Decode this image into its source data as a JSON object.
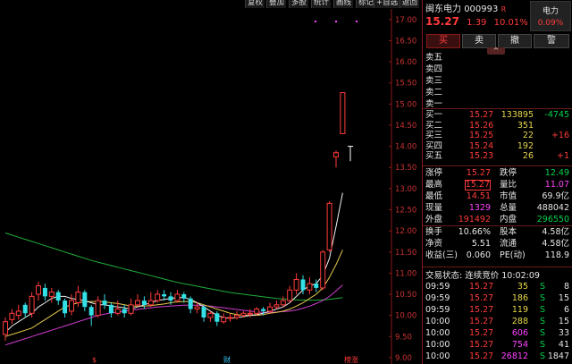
{
  "toolbar": {
    "buttons": [
      "复权",
      "叠加",
      "多股",
      "统计",
      "画线",
      "标记",
      "+自选",
      "返回"
    ]
  },
  "stock": {
    "name": "闽东电力",
    "code": "000993",
    "flag": "R",
    "price": "15.27",
    "change": "1.39",
    "pct": "10.01%",
    "sector": "电力",
    "sector_pct": "0.09%"
  },
  "actions": [
    "买",
    "卖",
    "撤",
    "警"
  ],
  "collapse": "^",
  "sell_levels": [
    {
      "label": "卖五",
      "price": "",
      "vol": ""
    },
    {
      "label": "卖四",
      "price": "",
      "vol": ""
    },
    {
      "label": "卖三",
      "price": "",
      "vol": ""
    },
    {
      "label": "卖二",
      "price": "",
      "vol": ""
    },
    {
      "label": "卖一",
      "price": "",
      "vol": ""
    }
  ],
  "buy_levels": [
    {
      "label": "买一",
      "price": "15.27",
      "vol": "133895",
      "chg": "-4745"
    },
    {
      "label": "买二",
      "price": "15.26",
      "vol": "351",
      "chg": ""
    },
    {
      "label": "买三",
      "price": "15.25",
      "vol": "22",
      "chg": "+16"
    },
    {
      "label": "买四",
      "price": "15.24",
      "vol": "192",
      "chg": ""
    },
    {
      "label": "买五",
      "price": "15.23",
      "vol": "26",
      "chg": "+1"
    }
  ],
  "stats": [
    {
      "l1": "涨停",
      "v1": "15.27",
      "l2": "跌停",
      "v2": "12.49"
    },
    {
      "l1": "最高",
      "v1": "15.27",
      "l2": "量比",
      "v2": "11.07"
    },
    {
      "l1": "最低",
      "v1": "14.51",
      "l2": "市值",
      "v2": "69.9亿"
    },
    {
      "l1": "现量",
      "v1": "1329",
      "l2": "总量",
      "v2": "488042"
    },
    {
      "l1": "外盘",
      "v1": "191492",
      "l2": "内盘",
      "v2": "296550"
    },
    {
      "l1": "换手",
      "v1": "10.66%",
      "l2": "股本",
      "v2": "4.58亿"
    },
    {
      "l1": "净资",
      "v1": "5.51",
      "l2": "流通",
      "v2": "4.58亿"
    },
    {
      "l1": "收益(三)",
      "v1": "0.060",
      "l2": "PE(动)",
      "v2": "118.9"
    }
  ],
  "trade_status": "交易状态: 连续竞价 10:02:09",
  "ticks": [
    {
      "t": "09:59",
      "p": "15.27",
      "v": "35",
      "s": "S",
      "n": "8"
    },
    {
      "t": "09:59",
      "p": "15.27",
      "v": "186",
      "s": "S",
      "n": "15"
    },
    {
      "t": "09:59",
      "p": "15.27",
      "v": "119",
      "s": "S",
      "n": "6"
    },
    {
      "t": "10:00",
      "p": "15.27",
      "v": "288",
      "s": "S",
      "n": "15"
    },
    {
      "t": "10:00",
      "p": "15.27",
      "v": "606",
      "s": "S",
      "n": "33"
    },
    {
      "t": "10:00",
      "p": "15.27",
      "v": "754",
      "s": "S",
      "n": "41"
    },
    {
      "t": "10:00",
      "p": "15.27",
      "v": "26812",
      "s": "S",
      "n": "1847"
    }
  ],
  "chart_data": {
    "type": "candlestick",
    "y_ticks": [
      "17.00",
      "16.50",
      "16.00",
      "15.50",
      "15.00",
      "14.50",
      "14.00",
      "13.50",
      "13.00",
      "12.50",
      "12.00",
      "11.50",
      "11.00",
      "10.50",
      "10.00",
      "9.50",
      "9.00"
    ],
    "ylim": [
      8.85,
      17.25
    ],
    "markers": [
      "$",
      "财",
      "榜涨"
    ],
    "candles": [
      [
        9.55,
        9.85,
        9.4,
        9.95
      ],
      [
        9.9,
        10.05,
        9.8,
        10.15
      ],
      [
        10.0,
        10.1,
        9.9,
        10.25
      ],
      [
        10.25,
        10.05,
        9.95,
        10.3
      ],
      [
        10.05,
        10.45,
        9.95,
        10.55
      ],
      [
        10.5,
        10.7,
        10.35,
        10.8
      ],
      [
        10.65,
        10.45,
        10.35,
        10.75
      ],
      [
        10.45,
        10.55,
        10.3,
        10.65
      ],
      [
        10.55,
        10.35,
        10.25,
        10.6
      ],
      [
        10.35,
        10.05,
        9.95,
        10.4
      ],
      [
        10.1,
        10.35,
        10.0,
        10.5
      ],
      [
        10.3,
        10.55,
        10.2,
        10.7
      ],
      [
        10.55,
        10.2,
        10.1,
        10.6
      ],
      [
        10.2,
        10.0,
        9.75,
        10.25
      ],
      [
        10.0,
        10.35,
        9.95,
        10.45
      ],
      [
        10.35,
        10.25,
        10.15,
        10.5
      ],
      [
        10.25,
        10.05,
        9.95,
        10.3
      ],
      [
        10.05,
        10.15,
        10.0,
        10.35
      ],
      [
        10.15,
        10.05,
        9.95,
        10.25
      ],
      [
        10.05,
        10.25,
        10.0,
        10.4
      ],
      [
        10.25,
        10.35,
        10.2,
        10.5
      ],
      [
        10.35,
        10.25,
        10.15,
        10.45
      ],
      [
        10.25,
        10.35,
        10.2,
        10.55
      ],
      [
        10.35,
        10.5,
        10.3,
        10.6
      ],
      [
        10.5,
        10.45,
        10.35,
        10.6
      ],
      [
        10.45,
        10.35,
        10.25,
        10.55
      ],
      [
        10.35,
        10.5,
        10.3,
        10.6
      ],
      [
        10.5,
        10.4,
        10.3,
        10.55
      ],
      [
        10.4,
        10.15,
        10.05,
        10.45
      ],
      [
        10.15,
        10.2,
        10.05,
        10.3
      ],
      [
        10.2,
        9.95,
        9.85,
        10.25
      ],
      [
        9.95,
        10.05,
        9.85,
        10.1
      ],
      [
        10.05,
        9.85,
        9.75,
        10.1
      ],
      [
        9.85,
        9.95,
        9.8,
        10.05
      ],
      [
        9.95,
        9.95,
        9.85,
        10.05
      ],
      [
        9.95,
        10.0,
        9.9,
        10.1
      ],
      [
        10.0,
        10.05,
        9.95,
        10.1
      ],
      [
        10.05,
        10.05,
        9.95,
        10.15
      ],
      [
        10.05,
        10.15,
        10.0,
        10.2
      ],
      [
        10.15,
        10.1,
        10.0,
        10.2
      ],
      [
        10.1,
        10.2,
        10.05,
        10.3
      ],
      [
        10.2,
        10.25,
        10.15,
        10.35
      ],
      [
        10.25,
        10.35,
        10.2,
        10.45
      ],
      [
        10.35,
        10.6,
        10.3,
        10.7
      ],
      [
        10.6,
        10.85,
        10.5,
        11.0
      ],
      [
        10.85,
        10.6,
        10.5,
        10.95
      ],
      [
        10.6,
        10.75,
        10.5,
        10.9
      ],
      [
        10.75,
        10.65,
        10.55,
        10.85
      ],
      [
        10.65,
        11.5,
        10.6,
        11.55
      ],
      [
        11.55,
        12.65,
        11.5,
        12.7
      ],
      [
        13.75,
        13.85,
        13.5,
        13.9
      ],
      [
        14.3,
        15.27,
        14.3,
        15.27
      ]
    ],
    "ma5": [
      9.6,
      9.75,
      9.85,
      9.95,
      10.05,
      10.2,
      10.3,
      10.4,
      10.45,
      10.45,
      10.4,
      10.38,
      10.35,
      10.3,
      10.25,
      10.25,
      10.22,
      10.2,
      10.18,
      10.15,
      10.2,
      10.25,
      10.3,
      10.35,
      10.38,
      10.4,
      10.42,
      10.42,
      10.38,
      10.3,
      10.2,
      10.1,
      10.0,
      9.95,
      9.93,
      9.95,
      9.97,
      10.0,
      10.02,
      10.05,
      10.1,
      10.15,
      10.2,
      10.3,
      10.45,
      10.6,
      10.7,
      10.75,
      10.95,
      11.35,
      12.1,
      12.9
    ],
    "ma10": [
      9.5,
      9.55,
      9.6,
      9.65,
      9.7,
      9.8,
      9.9,
      10.0,
      10.1,
      10.2,
      10.25,
      10.3,
      10.32,
      10.33,
      10.33,
      10.32,
      10.3,
      10.28,
      10.25,
      10.22,
      10.22,
      10.22,
      10.23,
      10.25,
      10.27,
      10.3,
      10.32,
      10.33,
      10.33,
      10.3,
      10.25,
      10.2,
      10.15,
      10.1,
      10.05,
      10.02,
      10.0,
      10.0,
      10.0,
      10.02,
      10.05,
      10.07,
      10.1,
      10.15,
      10.22,
      10.3,
      10.4,
      10.5,
      10.65,
      10.9,
      11.2,
      11.55
    ],
    "ma20": [
      9.3,
      9.35,
      9.4,
      9.45,
      9.5,
      9.55,
      9.6,
      9.65,
      9.7,
      9.75,
      9.8,
      9.85,
      9.9,
      9.95,
      10.0,
      10.03,
      10.06,
      10.08,
      10.1,
      10.12,
      10.14,
      10.16,
      10.18,
      10.2,
      10.21,
      10.22,
      10.23,
      10.24,
      10.24,
      10.24,
      10.23,
      10.22,
      10.2,
      10.18,
      10.16,
      10.14,
      10.12,
      10.1,
      10.08,
      10.07,
      10.07,
      10.08,
      10.09,
      10.1,
      10.13,
      10.17,
      10.22,
      10.28,
      10.35,
      10.45,
      10.58,
      10.72
    ],
    "ma60": [
      11.95,
      11.9,
      11.85,
      11.8,
      11.75,
      11.7,
      11.65,
      11.6,
      11.55,
      11.5,
      11.45,
      11.4,
      11.35,
      11.3,
      11.26,
      11.22,
      11.18,
      11.14,
      11.1,
      11.06,
      11.02,
      10.98,
      10.94,
      10.9,
      10.86,
      10.82,
      10.78,
      10.75,
      10.72,
      10.69,
      10.66,
      10.63,
      10.6,
      10.57,
      10.54,
      10.52,
      10.5,
      10.48,
      10.46,
      10.44,
      10.42,
      10.4,
      10.39,
      10.38,
      10.37,
      10.36,
      10.36,
      10.36,
      10.37,
      10.38,
      10.4,
      10.42
    ]
  }
}
